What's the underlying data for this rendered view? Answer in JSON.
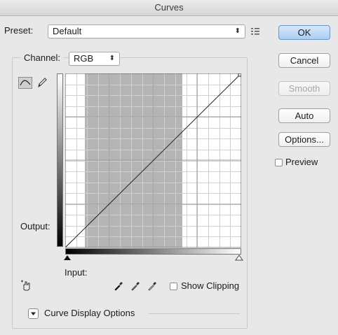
{
  "window": {
    "title": "Curves"
  },
  "preset": {
    "label": "Preset:",
    "value": "Default"
  },
  "channel": {
    "label": "Channel:",
    "value": "RGB"
  },
  "graph": {
    "output_label": "Output:",
    "input_label": "Input:"
  },
  "buttons": {
    "ok": "OK",
    "cancel": "Cancel",
    "smooth": "Smooth",
    "auto": "Auto",
    "options": "Options..."
  },
  "preview": {
    "label": "Preview",
    "checked": false
  },
  "show_clipping": {
    "label": "Show Clipping",
    "checked": false
  },
  "curve_display_options": {
    "label": "Curve Display Options"
  },
  "icons": {
    "preset_menu": "preset-options-icon",
    "curve_tool": "curve-point-tool-icon",
    "pencil_tool": "pencil-tool-icon",
    "targeted_adjust": "targeted-adjustment-hand-icon",
    "eyedroppers": [
      "black-point-eyedropper-icon",
      "gray-point-eyedropper-icon",
      "white-point-eyedropper-icon"
    ]
  },
  "colors": {
    "ok_button": "#a9cdf3",
    "shaded_region": "#b4b4b4"
  }
}
